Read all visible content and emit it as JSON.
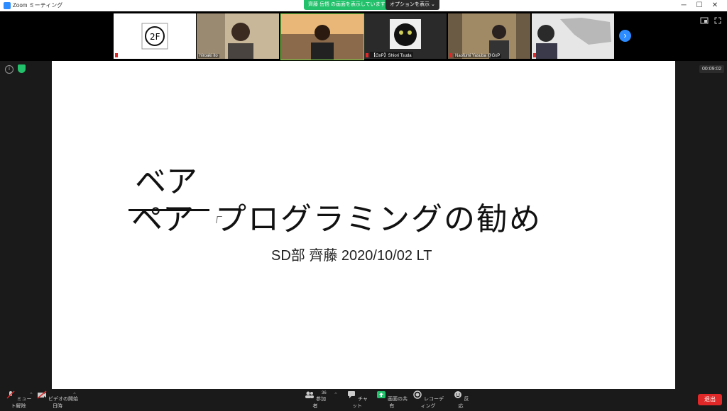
{
  "window": {
    "title": "Zoom ミーティング",
    "minimize": "─",
    "maximize": "☐",
    "close": "✕"
  },
  "share_banner": {
    "text": "齊藤 岳悟 の画面を表示しています",
    "options_label": "オプションを表示 ⌄"
  },
  "participants": [
    {
      "name": "",
      "bg": "#ffffff"
    },
    {
      "name": "hiroaki ito",
      "bg": "#c9b79a"
    },
    {
      "name": "",
      "bg": "#d9a45a"
    },
    {
      "name": "【GxP】Shiori Tsuda",
      "bg": "#2a2a2a"
    },
    {
      "name": "Naofumi Yasuba @GxP",
      "bg": "#6b5a44"
    },
    {
      "name": "",
      "bg": "#e6e6e6"
    }
  ],
  "next_label": "›",
  "timer": "00:09:02",
  "slide": {
    "furigana": "ベア",
    "title_struck": "ペア",
    "title_rest": "プログラミングの勧め",
    "subtitle": "SD部 齊藤 2020/10/02 LT"
  },
  "toolbar": {
    "mute": "ミュート解除",
    "video": "ビデオの開始日時",
    "participants": "参加者",
    "participants_count": "36",
    "chat": "チャット",
    "share": "画面の共有",
    "record": "レコーディング",
    "reactions": "反応",
    "leave": "退出"
  },
  "colors": {
    "accent": "#2d8cff",
    "share_green": "#23c16b",
    "leave_red": "#e02828"
  }
}
